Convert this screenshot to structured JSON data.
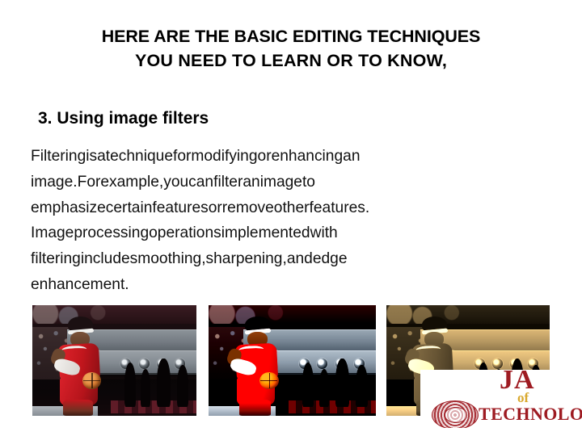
{
  "slide": {
    "background_color": "#ffffff",
    "title": {
      "line1": "HERE ARE THE BASIC EDITING TECHNIQUES",
      "line2": "YOU NEED TO LEARN OR TO KNOW,"
    },
    "subtitle": "3. Using image filters",
    "body": {
      "full_text": "Filtering is a technique for modifying or enhancing an image. For example, you can filter an image to emphasize certain features or remove other features. Image processing operations implemented with filtering include smoothing, sharpening, and edge enhancement.",
      "lines": [
        [
          "Filtering",
          "is",
          "a",
          "technique",
          "for",
          "modifying",
          "or",
          "enhancing",
          "an"
        ],
        [
          "image.",
          "For",
          "example,",
          "you",
          "can",
          "filter",
          "an",
          "image",
          "to"
        ],
        [
          "emphasize",
          "certain",
          "features",
          "or",
          "remove",
          "other",
          "features."
        ],
        [
          "Image",
          "processing",
          "operations",
          "implemented",
          "with"
        ],
        [
          "filtering",
          "include",
          "smoothing,",
          "sharpening,",
          "and",
          "edge"
        ],
        [
          "enhancement."
        ]
      ]
    },
    "images": [
      {
        "id": "photo-1",
        "caption": "original basketball photo",
        "filter": "none"
      },
      {
        "id": "photo-2",
        "caption": "sharpened / contrast enhanced basketball photo",
        "filter": "contrast-saturate"
      },
      {
        "id": "photo-3",
        "caption": "sepia toned basketball photo",
        "filter": "sepia"
      }
    ],
    "logo": {
      "word": "JA",
      "of": "of",
      "technology": "TECHNOLOGY",
      "seal_color": "#9e1b22",
      "accent_color": "#d9a92e"
    }
  }
}
